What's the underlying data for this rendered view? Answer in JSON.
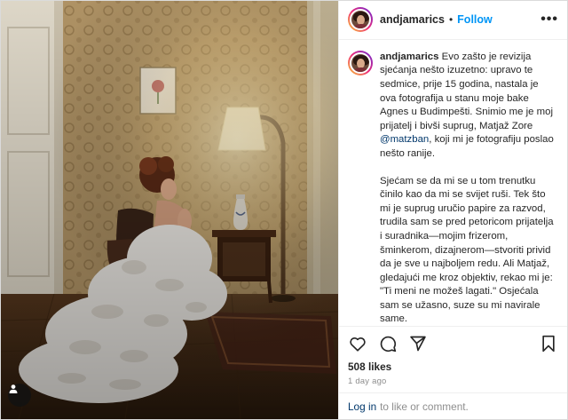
{
  "post": {
    "username": "andjamarics",
    "follow_label": "Follow",
    "separator": "•",
    "more_label": "•••",
    "caption": {
      "username": "andjamarics",
      "part1_before_mention": "Evo zašto je revizija sjećanja nešto izuzetno: upravo te sedmice, prije 15 godina, nastala je ova fotografija u stanu moje bake Agnes u Budimpešti. Snimio me je moj prijatelj i bivši suprug, Matjaž Zore ",
      "mention": "@matzban",
      "part1_after_mention": ", koji mi je fotografiju poslao nešto ranije.",
      "part2": "Sjećam se da mi se u tom trenutku činilo kao da mi se svijet ruši. Tek što mi je suprug uručio papire za razvod, trudila sam se pred petoricom prijatelja i suradnika—mojim frizerom, šminkerom, dizajnerom—stvoriti privid da je sve u najboljem redu. Ali Matjaž, gledajući me kroz objektiv, rekao mi je: \"Ti meni ne možeš lagati.\" Osjećala sam se užasno, suze su mi navirale same."
    },
    "likes": "508 likes",
    "timestamp": "1 day ago",
    "login": {
      "link": "Log in",
      "text": "to like or comment."
    },
    "icons": {
      "like": "heart-icon",
      "comment": "comment-icon",
      "share": "paper-plane-icon",
      "save": "bookmark-icon",
      "tag": "person-tag-icon"
    },
    "colors": {
      "follow_blue": "#0095f6",
      "mention_blue": "#00376b",
      "muted_gray": "#8e8e8e"
    }
  }
}
